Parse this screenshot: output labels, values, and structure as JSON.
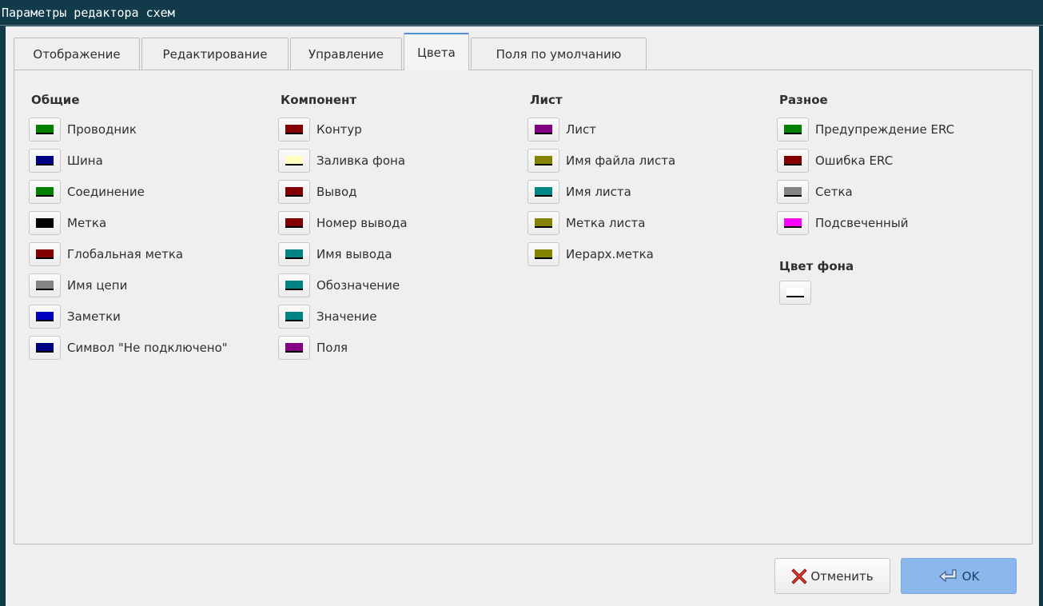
{
  "window": {
    "title": "Параметры редактора схем"
  },
  "tabs": [
    {
      "label": "Отображение",
      "active": false
    },
    {
      "label": "Редактирование",
      "active": false
    },
    {
      "label": "Управление",
      "active": false
    },
    {
      "label": "Цвета",
      "active": true
    },
    {
      "label": "Поля по умолчанию",
      "active": false
    }
  ],
  "groups": {
    "general": {
      "title": "Общие",
      "items": [
        {
          "label": "Проводник",
          "color": "#008000"
        },
        {
          "label": "Шина",
          "color": "#000084"
        },
        {
          "label": "Соединение",
          "color": "#008000"
        },
        {
          "label": "Метка",
          "color": "#000000"
        },
        {
          "label": "Глобальная метка",
          "color": "#840000"
        },
        {
          "label": "Имя цепи",
          "color": "#848484"
        },
        {
          "label": "Заметки",
          "color": "#0000c2"
        },
        {
          "label": "Символ \"Не подключено\"",
          "color": "#000084"
        }
      ]
    },
    "component": {
      "title": "Компонент",
      "items": [
        {
          "label": "Контур",
          "color": "#840000"
        },
        {
          "label": "Заливка фона",
          "color": "#ffffc2"
        },
        {
          "label": "Вывод",
          "color": "#840000"
        },
        {
          "label": "Номер вывода",
          "color": "#840000"
        },
        {
          "label": "Имя вывода",
          "color": "#008484"
        },
        {
          "label": "Обозначение",
          "color": "#008484"
        },
        {
          "label": "Значение",
          "color": "#008484"
        },
        {
          "label": "Поля",
          "color": "#840084"
        }
      ]
    },
    "sheet": {
      "title": "Лист",
      "items": [
        {
          "label": "Лист",
          "color": "#840084"
        },
        {
          "label": "Имя файла листа",
          "color": "#848400"
        },
        {
          "label": "Имя листа",
          "color": "#008484"
        },
        {
          "label": "Метка листа",
          "color": "#848400"
        },
        {
          "label": "Иерарх.метка",
          "color": "#848400"
        }
      ]
    },
    "misc": {
      "title": "Разное",
      "items": [
        {
          "label": "Предупреждение ERC",
          "color": "#008000"
        },
        {
          "label": "Ошибка ERC",
          "color": "#840000"
        },
        {
          "label": "Сетка",
          "color": "#848484"
        },
        {
          "label": "Подсвеченный",
          "color": "#ff00ff"
        }
      ]
    },
    "background": {
      "title": "Цвет фона",
      "color": "#ffffff"
    }
  },
  "buttons": {
    "cancel": "Отменить",
    "ok": "OK"
  }
}
